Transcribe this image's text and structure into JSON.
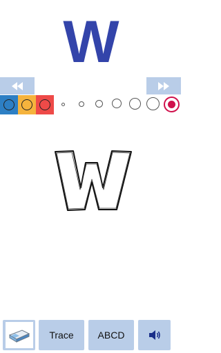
{
  "header": {
    "letter": "W"
  },
  "nav": {
    "prev_icon": "rewind-icon",
    "next_icon": "fast-forward-icon"
  },
  "palette": {
    "colors": [
      {
        "name": "blue",
        "hex": "#2d7fc4"
      },
      {
        "name": "yellow",
        "hex": "#f5b33d"
      },
      {
        "name": "red",
        "hex": "#ee4a48"
      }
    ],
    "brush_sizes": 7,
    "selected_brush_color": "#d0104c"
  },
  "canvas": {
    "outline_letter": "W"
  },
  "bottom_bar": {
    "eraser_icon": "eraser-icon",
    "trace_label": "Trace",
    "abcd_label": "ABCD",
    "sound_icon": "speaker-icon"
  }
}
